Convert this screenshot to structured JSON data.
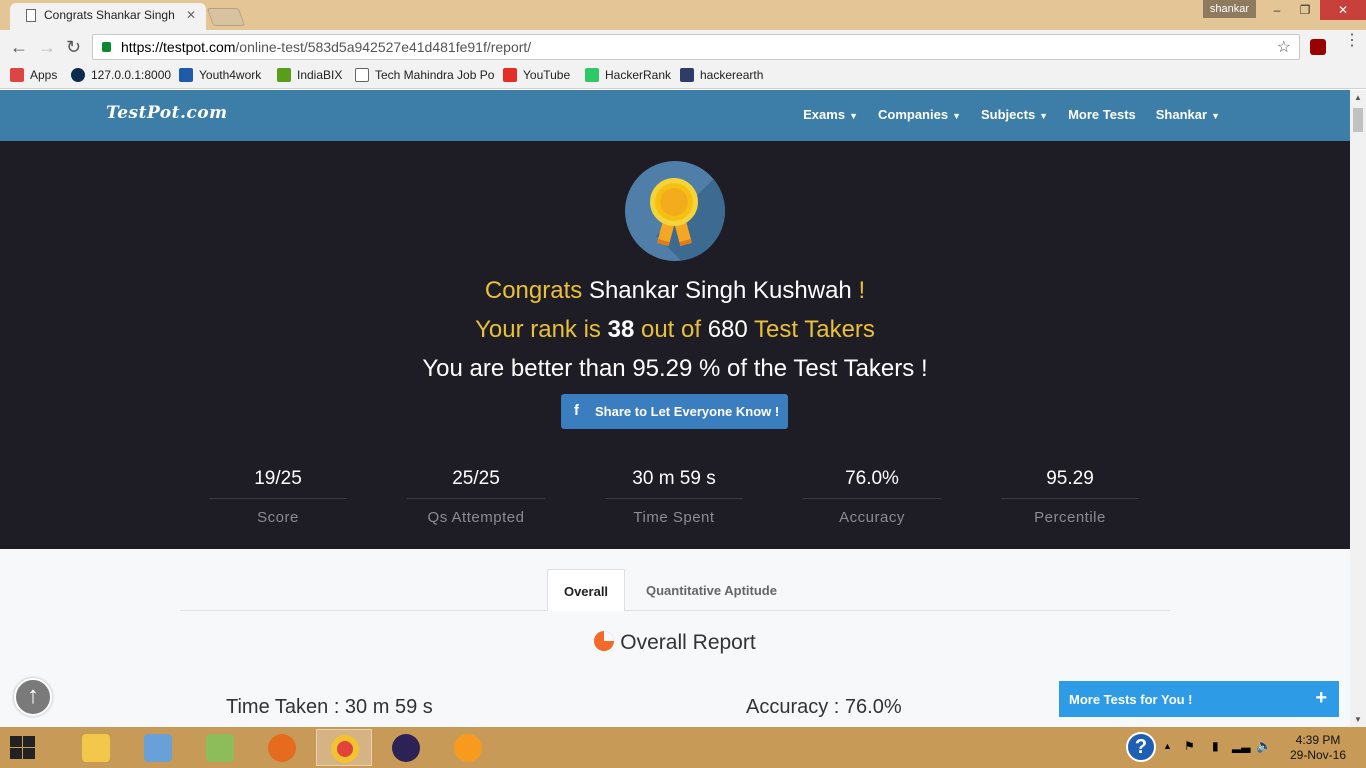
{
  "browser": {
    "tab_title": "Congrats Shankar Singh",
    "user_chip": "shankar",
    "url_host": "https://testpot.com",
    "url_path": "/online-test/583d5a942527e41d481fe91f/report/",
    "bookmarks": [
      {
        "label": "Apps",
        "icon": "apps-grid-icon",
        "color": "#d44"
      },
      {
        "label": "127.0.0.1:8000",
        "icon": "globe-icon",
        "color": "#0d2b4a"
      },
      {
        "label": "Youth4work",
        "icon": "youth4work-icon",
        "color": "#1f5ca8"
      },
      {
        "label": "IndiaBIX",
        "icon": "indiabix-icon",
        "color": "#5a9c1c"
      },
      {
        "label": "Tech Mahindra Job Po",
        "icon": "page-icon",
        "color": "#ffffff"
      },
      {
        "label": "YouTube",
        "icon": "youtube-icon",
        "color": "#e52d27"
      },
      {
        "label": "HackerRank",
        "icon": "hackerrank-icon",
        "color": "#2ec866"
      },
      {
        "label": "hackerearth",
        "icon": "hackerearth-icon",
        "color": "#2c3e66"
      }
    ]
  },
  "site": {
    "logo": "TestPot.com",
    "nav": [
      {
        "label": "Exams",
        "caret": true
      },
      {
        "label": "Companies",
        "caret": true
      },
      {
        "label": "Subjects",
        "caret": true
      },
      {
        "label": "More Tests",
        "caret": false
      },
      {
        "label": "Shankar",
        "caret": true
      }
    ],
    "hero": {
      "congrats": "Congrats",
      "name": "Shankar Singh Kushwah",
      "exclaim": "!",
      "rank_prefix": "Your rank is",
      "rank": "38",
      "out_of": "out of",
      "total": "680",
      "takers": "Test Takers",
      "better_than": "You are better than 95.29 % of the Test Takers !",
      "share_label": "Share to Let Everyone Know !"
    },
    "stats": [
      {
        "value": "19/25",
        "label": "Score"
      },
      {
        "value": "25/25",
        "label": "Qs Attempted"
      },
      {
        "value": "30 m 59 s",
        "label": "Time Spent"
      },
      {
        "value": "76.0%",
        "label": "Accuracy"
      },
      {
        "value": "95.29",
        "label": "Percentile"
      }
    ],
    "tabs": [
      "Overall",
      "Quantitative Aptitude"
    ],
    "report_title": "Overall Report",
    "time_taken": "Time Taken : 30 m 59 s",
    "accuracy": "Accuracy : 76.0%",
    "more_tests": "More Tests for You !",
    "plus": "+"
  },
  "taskbar": {
    "time": "4:39 PM",
    "date": "29-Nov-16"
  },
  "colors": {
    "nav_bg": "#3c7ea8",
    "hero_bg": "#1e1c24",
    "gold": "#e8c03a",
    "share_blue": "#3b7ec0"
  }
}
